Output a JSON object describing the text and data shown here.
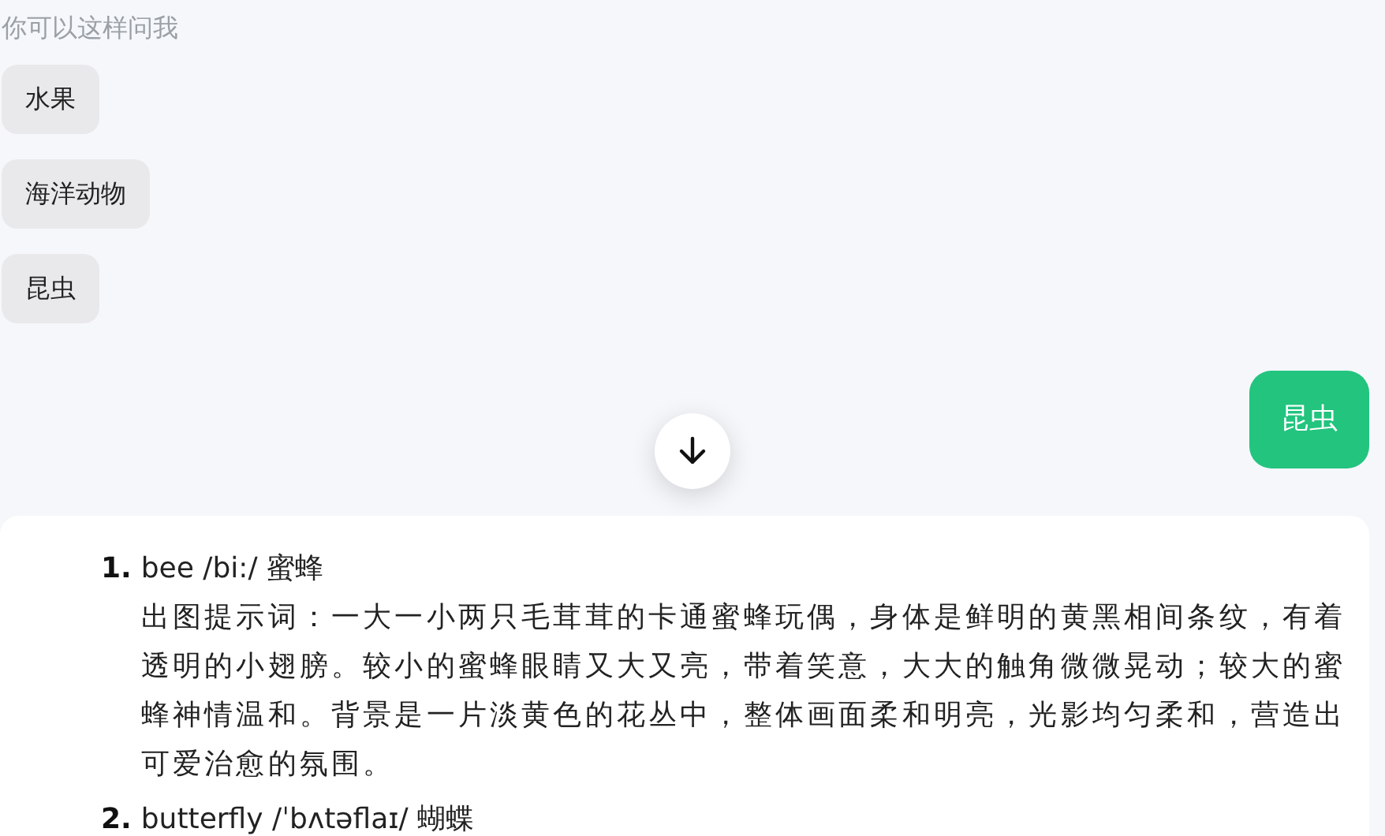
{
  "suggestions": {
    "title": "你可以这样问我",
    "items": [
      "水果",
      "海洋动物",
      "昆虫"
    ]
  },
  "user_message": "昆虫",
  "answer": {
    "items": [
      {
        "number": "1.",
        "heading": "bee /bi:/ 蜜蜂",
        "body": "出图提示词：一大一小两只毛茸茸的卡通蜜蜂玩偶，身体是鲜明的黄黑相间条纹，有着透明的小翅膀。较小的蜜蜂眼睛又大又亮，带着笑意，大大的触角微微晃动；较大的蜜蜂神情温和。背景是一片淡黄色的花丛中，整体画面柔和明亮，光影均匀柔和，营造出可爱治愈的氛围。"
      },
      {
        "number": "2.",
        "heading": "butterfly /ˈbʌtəflaɪ/ 蝴蝶"
      }
    ]
  }
}
